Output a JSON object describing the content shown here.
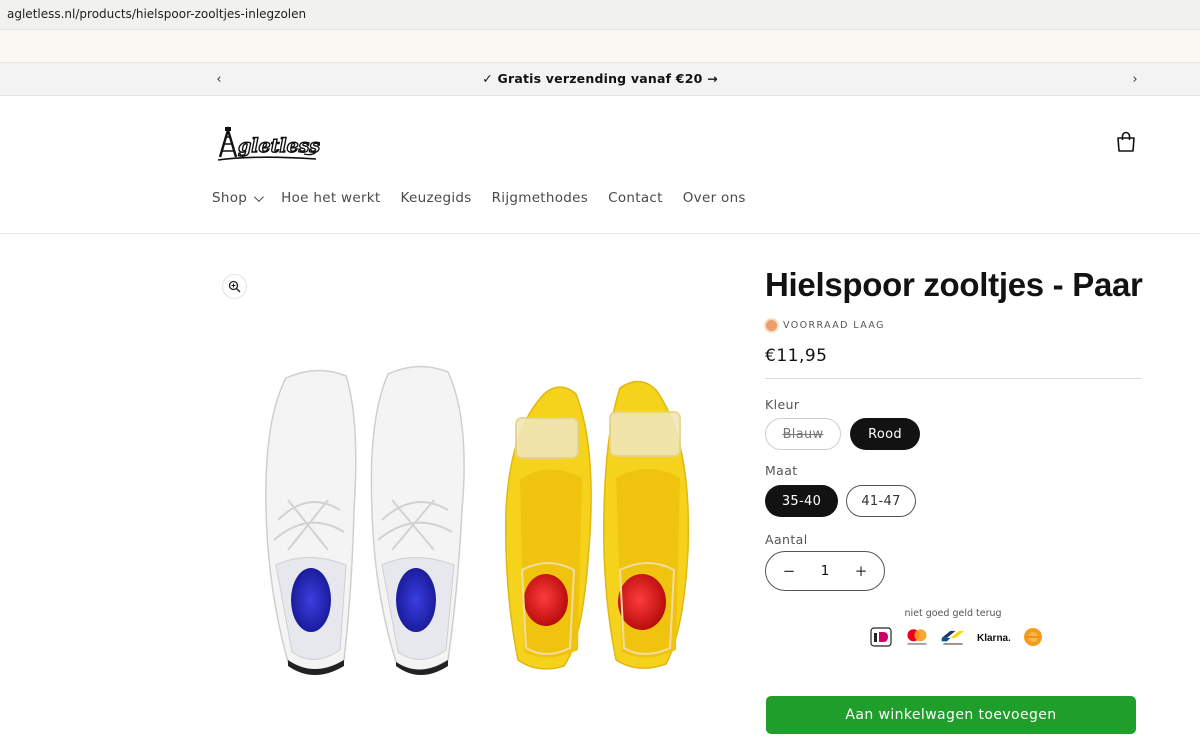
{
  "browser": {
    "url": "agletless.nl/products/hielspoor-zooltjes-inlegzolen"
  },
  "announcement": {
    "check": "✓",
    "text": "Gratis verzending vanaf €20",
    "arrow": "→",
    "prev": "‹",
    "next": "›"
  },
  "header": {
    "logo_text": "Agletless",
    "nav": [
      {
        "label": "Shop",
        "has_dropdown": true
      },
      {
        "label": "Hoe het werkt"
      },
      {
        "label": "Keuzegids"
      },
      {
        "label": "Rijgmethodes"
      },
      {
        "label": "Contact"
      },
      {
        "label": "Over ons"
      }
    ]
  },
  "product": {
    "title": "Hielspoor zooltjes - Paar",
    "stock": "VOORRAAD LAAG",
    "price": "€11,95",
    "colour_label": "Kleur",
    "colours": [
      {
        "label": "Blauw",
        "selected": false,
        "available": false
      },
      {
        "label": "Rood",
        "selected": true,
        "available": true
      }
    ],
    "size_label": "Maat",
    "sizes": [
      {
        "label": "35-40",
        "selected": true
      },
      {
        "label": "41-47",
        "selected": false
      }
    ],
    "quantity_label": "Aantal",
    "quantity": "1",
    "minus": "−",
    "plus": "+",
    "guarantee": "niet goed geld terug",
    "payment_methods": [
      "iDEAL",
      "Mastercard",
      "Bancontact",
      "Klarna.",
      "PostNL"
    ],
    "add_to_cart": "Aan winkelwagen toevoegen"
  },
  "colors": {
    "accent_green": "#1f9e2b",
    "stock_dot": "#e9a06a",
    "selected_pill": "#121212"
  }
}
